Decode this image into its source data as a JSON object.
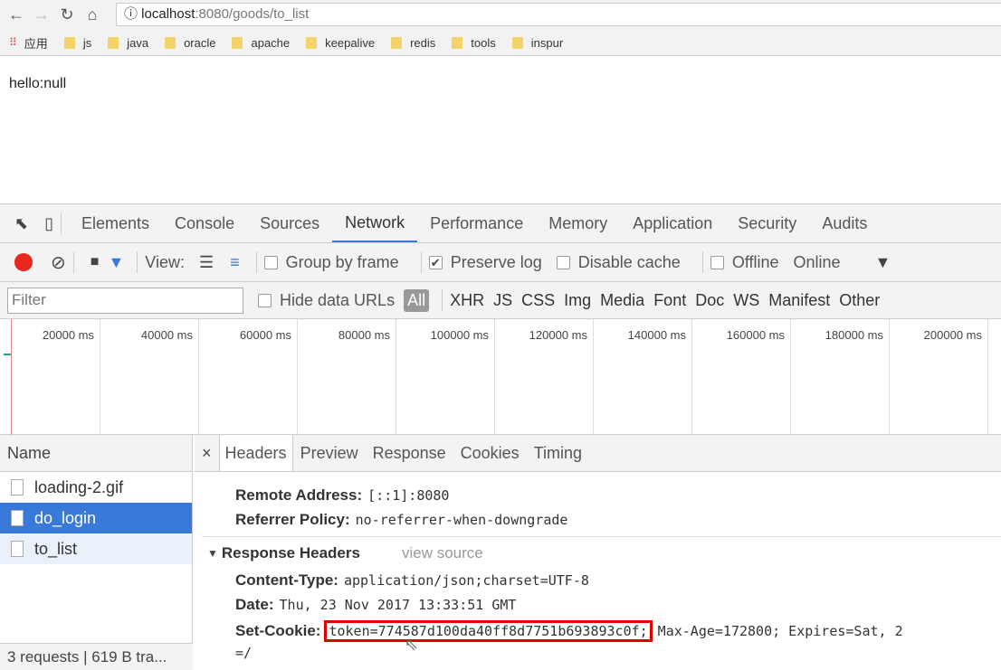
{
  "browser": {
    "url_host": "localhost",
    "url_path": ":8080/goods/to_list",
    "apps_label": "应用",
    "bookmarks": [
      "js",
      "java",
      "oracle",
      "apache",
      "keepalive",
      "redis",
      "tools",
      "inspur"
    ]
  },
  "page": {
    "text": "hello:null"
  },
  "devtools": {
    "tabs": [
      "Elements",
      "Console",
      "Sources",
      "Network",
      "Performance",
      "Memory",
      "Application",
      "Security",
      "Audits"
    ],
    "active_tab": "Network",
    "toolbar": {
      "view_label": "View:",
      "group_by_frame": "Group by frame",
      "preserve_log": "Preserve log",
      "disable_cache": "Disable cache",
      "offline": "Offline",
      "throttle": "Online"
    },
    "filter": {
      "placeholder": "Filter",
      "hide_data_urls": "Hide data URLs",
      "types": [
        "All",
        "XHR",
        "JS",
        "CSS",
        "Img",
        "Media",
        "Font",
        "Doc",
        "WS",
        "Manifest",
        "Other"
      ]
    },
    "timeline_ticks": [
      "20000 ms",
      "40000 ms",
      "60000 ms",
      "80000 ms",
      "100000 ms",
      "120000 ms",
      "140000 ms",
      "160000 ms",
      "180000 ms",
      "200000 ms"
    ],
    "name_header": "Name",
    "requests": [
      "loading-2.gif",
      "do_login",
      "to_list"
    ],
    "selected_request": "do_login",
    "status_bar": "3 requests | 619 B tra...",
    "detail_tabs": [
      "Headers",
      "Preview",
      "Response",
      "Cookies",
      "Timing"
    ],
    "general": [
      {
        "k": "Remote Address:",
        "v": "[::1]:8080"
      },
      {
        "k": "Referrer Policy:",
        "v": "no-referrer-when-downgrade"
      }
    ],
    "response_headers_title": "Response Headers",
    "view_source": "view source",
    "response_headers": [
      {
        "k": "Content-Type:",
        "v": "application/json;charset=UTF-8"
      },
      {
        "k": "Date:",
        "v": "Thu, 23 Nov 2017 13:33:51 GMT"
      }
    ],
    "set_cookie": {
      "k": "Set-Cookie:",
      "token": "token=774587d100da40ff8d7751b693893c0f;",
      "rest": "Max-Age=172800; Expires=Sat, 2",
      "cont": "=/"
    },
    "highlight_color": "#e00000"
  }
}
